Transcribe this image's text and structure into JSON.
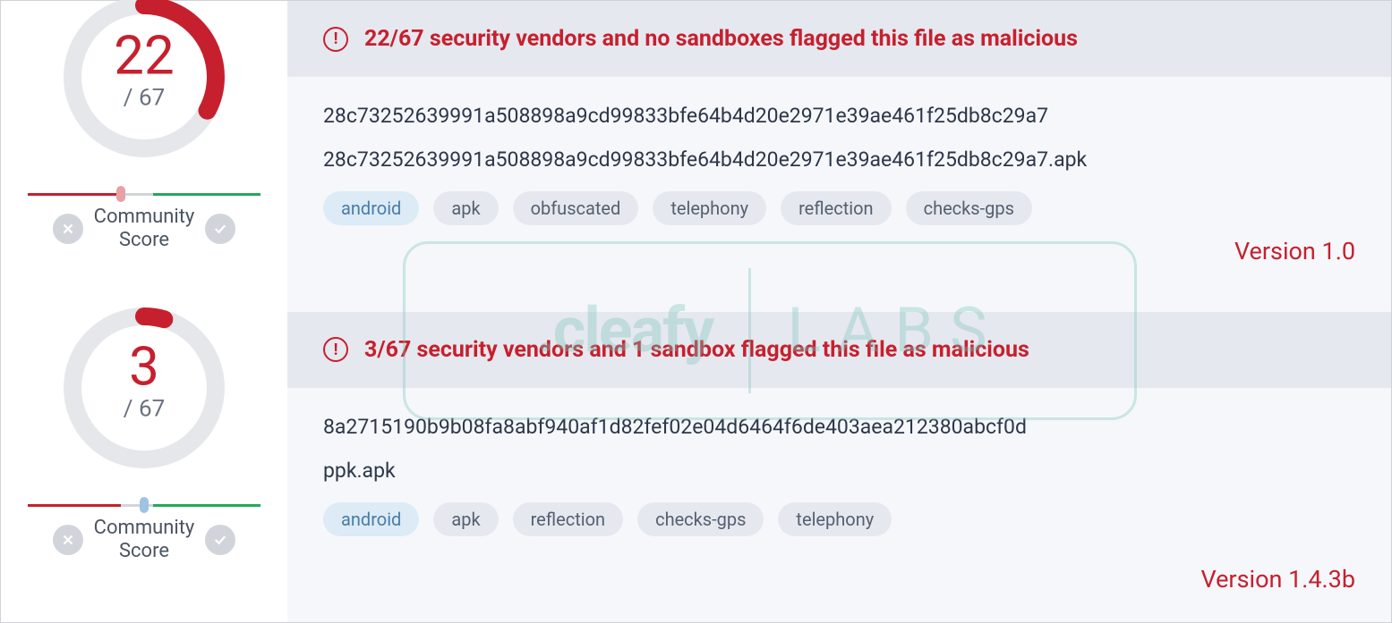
{
  "watermark": {
    "left": ".cleafy",
    "right": "LABS"
  },
  "scans": [
    {
      "score": "22",
      "total": "/ 67",
      "gauge_frac": 0.328,
      "marker_color": "red",
      "community_label_line1": "Community",
      "community_label_line2": "Score",
      "alert": "22/67 security vendors and no sandboxes flagged this file as malicious",
      "hash": "28c73252639991a508898a9cd99833bfe64b4d20e2971e39ae461f25db8c29a7",
      "filename": "28c73252639991a508898a9cd99833bfe64b4d20e2971e39ae461f25db8c29a7.apk",
      "tags": [
        {
          "label": "android",
          "primary": true
        },
        {
          "label": "apk",
          "primary": false
        },
        {
          "label": "obfuscated",
          "primary": false
        },
        {
          "label": "telephony",
          "primary": false
        },
        {
          "label": "reflection",
          "primary": false
        },
        {
          "label": "checks-gps",
          "primary": false
        }
      ],
      "version": "Version 1.0",
      "version_class": "v1"
    },
    {
      "score": "3",
      "total": "/ 67",
      "gauge_frac": 0.045,
      "marker_color": "blue",
      "community_label_line1": "Community",
      "community_label_line2": "Score",
      "alert": "3/67 security vendors and 1 sandbox flagged this file as malicious",
      "hash": "8a2715190b9b08fa8abf940af1d82fef02e04d6464f6de403aea212380abcf0d",
      "filename": "ppk.apk",
      "tags": [
        {
          "label": "android",
          "primary": true
        },
        {
          "label": "apk",
          "primary": false
        },
        {
          "label": "reflection",
          "primary": false
        },
        {
          "label": "checks-gps",
          "primary": false
        },
        {
          "label": "telephony",
          "primary": false
        }
      ],
      "version": "Version 1.4.3b",
      "version_class": "v2"
    }
  ]
}
